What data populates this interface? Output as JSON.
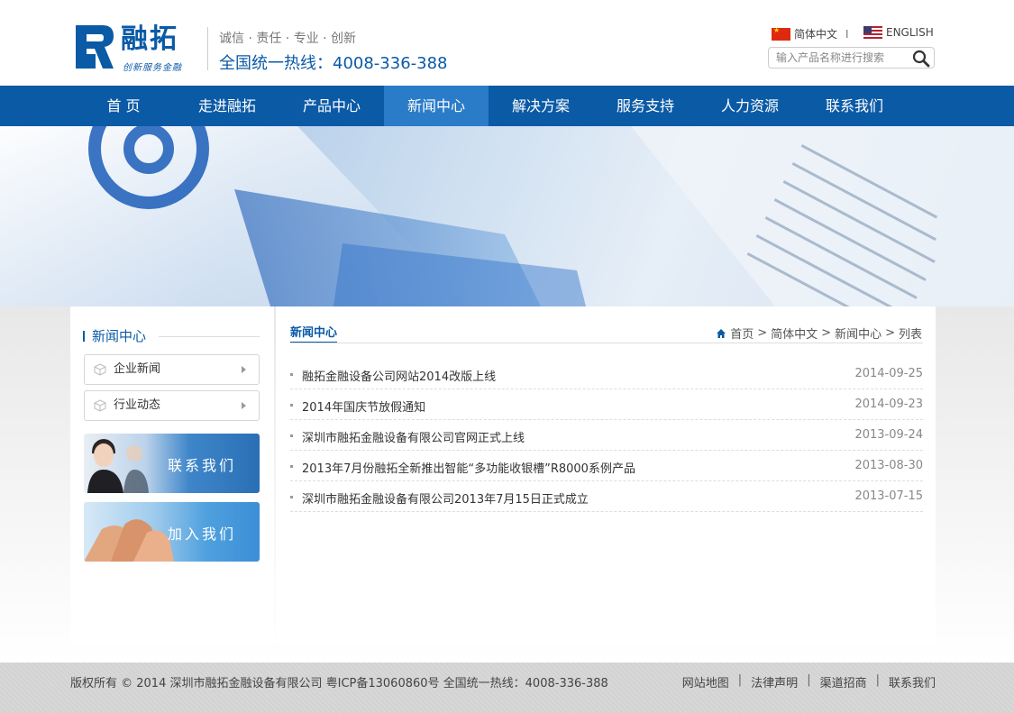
{
  "header": {
    "logo_title": "融拓",
    "logo_sub": "创新服务金融",
    "slogan": "诚信 · 责任 · 专业 · 创新",
    "hotline": "全国统一热线：4008-336-388",
    "lang_cn": "简体中文",
    "lang_sep": "I",
    "lang_en": "ENGLISH",
    "search_placeholder": "输入产品名称进行搜索"
  },
  "nav": {
    "items": [
      "首 页",
      "走进融拓",
      "产品中心",
      "新闻中心",
      "解决方案",
      "服务支持",
      "人力资源",
      "联系我们"
    ],
    "active_index": 3
  },
  "sidebar": {
    "title": "新闻中心",
    "links": [
      "企业新闻",
      "行业动态"
    ],
    "promo_contact": "联系我们",
    "promo_join": "加入我们"
  },
  "main": {
    "title": "新闻中心",
    "breadcrumb": [
      "首页",
      "简体中文",
      "新闻中心",
      "列表"
    ],
    "breadcrumb_sep": ">",
    "news": [
      {
        "title": "融拓金融设备公司网站2014改版上线",
        "date": "2014-09-25"
      },
      {
        "title": "2014年国庆节放假通知",
        "date": "2014-09-23"
      },
      {
        "title": "深圳市融拓金融设备有限公司官网正式上线",
        "date": "2013-09-24"
      },
      {
        "title": "2013年7月份融拓全新推出智能“多功能收银槽”R8000系例产品",
        "date": "2013-08-30"
      },
      {
        "title": "深圳市融拓金融设备有限公司2013年7月15日正式成立",
        "date": "2013-07-15"
      }
    ]
  },
  "footer": {
    "copyright": "版权所有 © 2014 深圳市融拓金融设备有限公司 粤ICP备13060860号 全国统一热线：4008-336-388",
    "links": [
      "网站地图",
      "法律声明",
      "渠道招商",
      "联系我们"
    ],
    "sep": "|"
  },
  "colors": {
    "brand_blue": "#0b5aa6",
    "nav_active": "#2a7cc8"
  }
}
